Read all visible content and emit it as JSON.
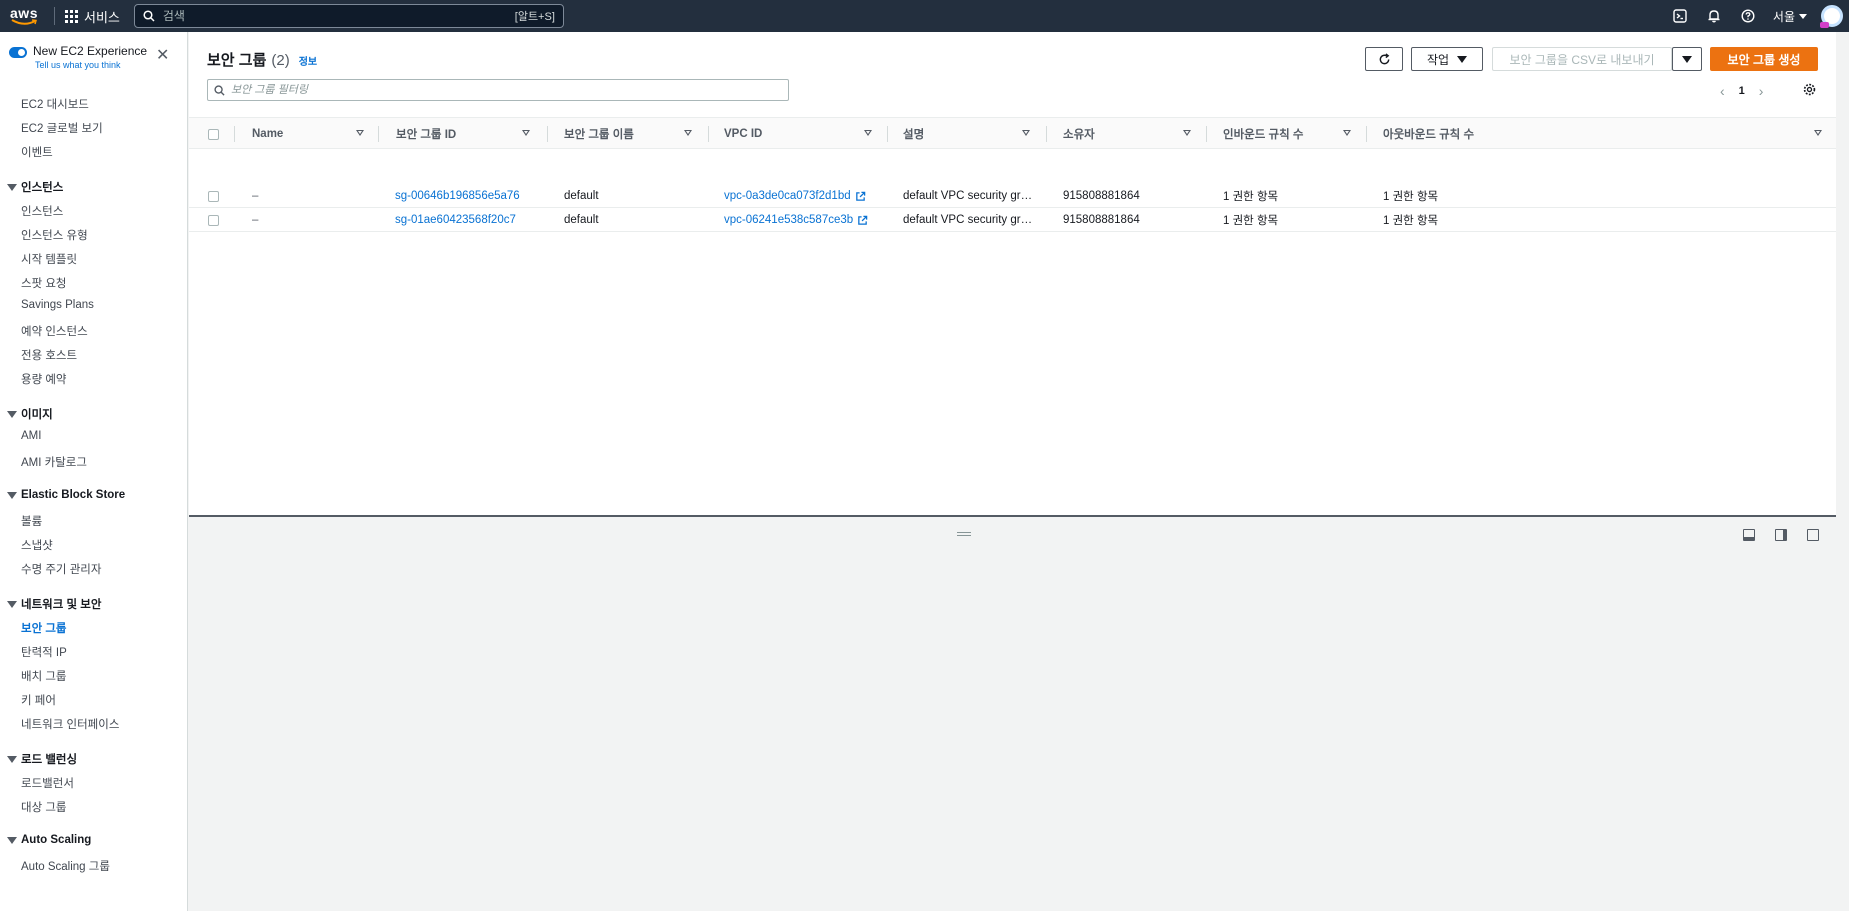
{
  "topbar": {
    "logo_text": "aws",
    "services_label": "서비스",
    "search_placeholder": "검색",
    "search_shortcut": "[알트+S]",
    "region": "서울"
  },
  "sidebar": {
    "experience_title": "New EC2 Experience",
    "experience_link": "Tell us what you think",
    "top_items": [
      "EC2 대시보드",
      "EC2 글로벌 보기",
      "이벤트"
    ],
    "sections": [
      {
        "title": "인스턴스",
        "items": [
          "인스턴스",
          "인스턴스 유형",
          "시작 템플릿",
          "스팟 요청",
          "Savings Plans",
          "예약 인스턴스",
          "전용 호스트",
          "용량 예약"
        ]
      },
      {
        "title": "이미지",
        "items": [
          "AMI",
          "AMI 카탈로그"
        ]
      },
      {
        "title": "Elastic Block Store",
        "items": [
          "볼륨",
          "스냅샷",
          "수명 주기 관리자"
        ]
      },
      {
        "title": "네트워크 및 보안",
        "items": [
          "보안 그룹",
          "탄력적 IP",
          "배치 그룹",
          "키 페어",
          "네트워크 인터페이스"
        ]
      },
      {
        "title": "로드 밸런싱",
        "items": [
          "로드밸런서",
          "대상 그룹"
        ]
      },
      {
        "title": "Auto Scaling",
        "items": [
          "Auto Scaling 그룹"
        ]
      }
    ],
    "active_item": "보안 그룹"
  },
  "main": {
    "title": "보안 그룹",
    "count": "(2)",
    "info": "정보",
    "actions_label": "작업",
    "export_label": "보안 그룹을 CSV로 내보내기",
    "create_label": "보안 그룹 생성",
    "filter_placeholder": "보안 그룹 필터링",
    "page_number": "1",
    "columns": [
      "Name",
      "보안 그룹 ID",
      "보안 그룹 이름",
      "VPC ID",
      "설명",
      "소유자",
      "인바운드 규칙 수",
      "아웃바운드 규칙 수"
    ],
    "rows": [
      {
        "name": "–",
        "sg_id": "sg-00646b196856e5a76",
        "sg_name": "default",
        "vpc_id": "vpc-0a3de0ca073f2d1bd",
        "description": "default VPC security gr…",
        "owner": "915808881864",
        "inbound": "1 권한 항목",
        "outbound": "1 권한 항목"
      },
      {
        "name": "–",
        "sg_id": "sg-01ae60423568f20c7",
        "sg_name": "default",
        "vpc_id": "vpc-06241e538c587ce3b",
        "description": "default VPC security gr…",
        "owner": "915808881864",
        "inbound": "1 권한 항목",
        "outbound": "1 권한 항목"
      }
    ]
  },
  "colors": {
    "topbar": "#232f3e",
    "accent": "#0972d3",
    "primary_button": "#ec7211"
  }
}
